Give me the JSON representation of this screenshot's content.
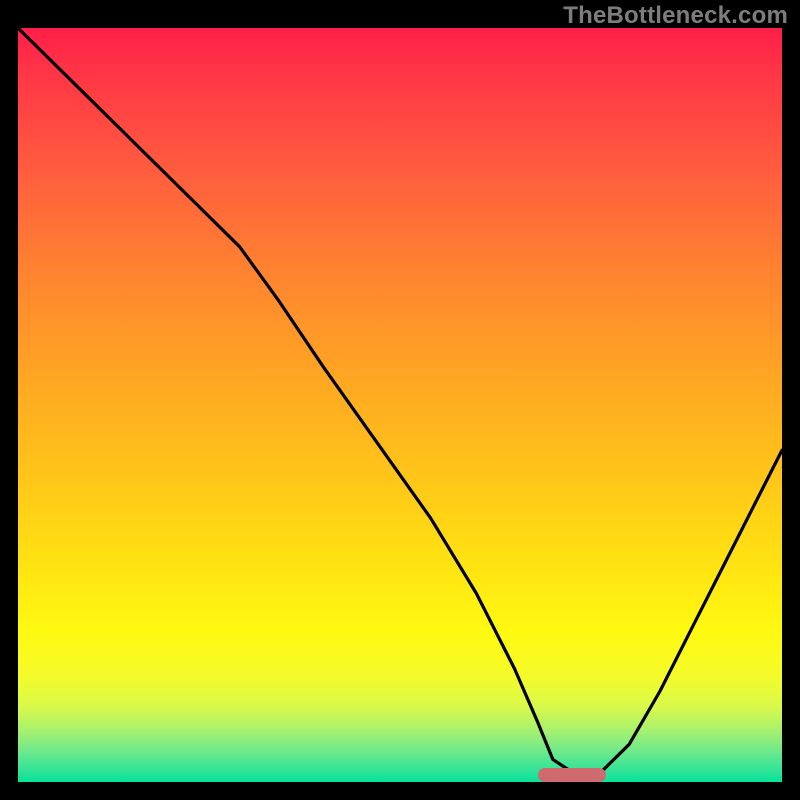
{
  "watermark": "TheBottleneck.com",
  "colors": {
    "gradient_top": "#ff1e4a",
    "gradient_bottom": "#02e59a",
    "curve": "#000000",
    "marker": "#cf6a6e",
    "frame_bg": "#000000"
  },
  "chart_data": {
    "type": "line",
    "title": "",
    "xlabel": "",
    "ylabel": "",
    "xlim": [
      0,
      100
    ],
    "ylim": [
      0,
      100
    ],
    "grid": false,
    "legend": false,
    "series": [
      {
        "name": "bottleneck-curve",
        "x": [
          0,
          8,
          16,
          24,
          29,
          34,
          40,
          47,
          54,
          60,
          65,
          68,
          70,
          73,
          76,
          80,
          84,
          88,
          92,
          96,
          100
        ],
        "values": [
          100,
          92,
          84,
          76,
          71,
          64,
          55,
          45,
          35,
          25,
          15,
          8,
          3,
          1,
          1,
          5,
          12,
          20,
          28,
          36,
          44
        ]
      }
    ],
    "annotations": [
      {
        "name": "optimal-marker",
        "x_center": 72.5,
        "y": 0.5,
        "width_pct": 9
      }
    ]
  }
}
